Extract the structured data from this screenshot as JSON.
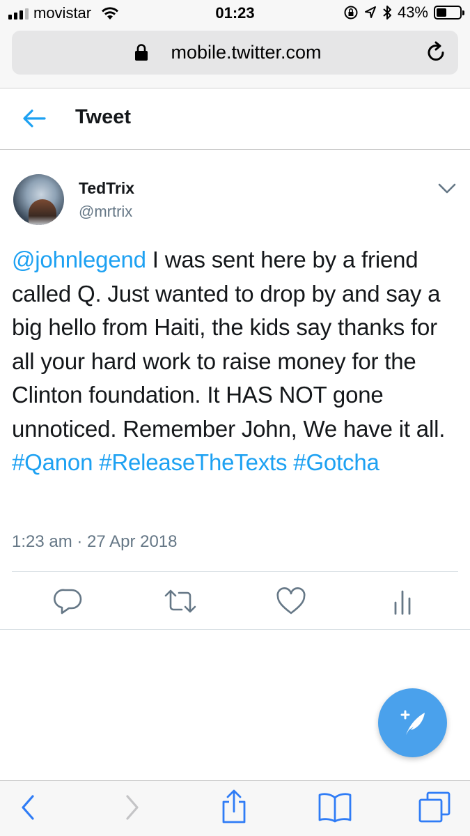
{
  "status_bar": {
    "carrier": "movistar",
    "time": "01:23",
    "battery_percent": "43%",
    "battery_level": 0.43
  },
  "browser": {
    "url": "mobile.twitter.com"
  },
  "header": {
    "title": "Tweet"
  },
  "tweet": {
    "display_name": "TedTrix",
    "handle": "@mrtrix",
    "mention": "@johnlegend",
    "text_body": " I was sent here by a friend called Q. Just wanted to drop by and say a big hello from Haiti, the kids say thanks for all your hard work to raise money for the Clinton foundation. It HAS NOT gone unnoticed. Remember John, We have it all.",
    "hashtags": [
      "#Qanon",
      "#ReleaseTheTexts",
      "#Gotcha"
    ],
    "timestamp": "1:23 am · 27 Apr 2018"
  },
  "icons": {
    "back": "arrow-left-icon",
    "more": "chevron-down-icon",
    "reply": "reply-icon",
    "retweet": "retweet-icon",
    "like": "heart-icon",
    "analytics": "analytics-icon",
    "compose": "compose-tweet-icon"
  },
  "colors": {
    "accent": "#1da1f2",
    "fab": "#4aa1ec",
    "secondary_text": "#657786",
    "ios_blue": "#2f7cf6"
  }
}
